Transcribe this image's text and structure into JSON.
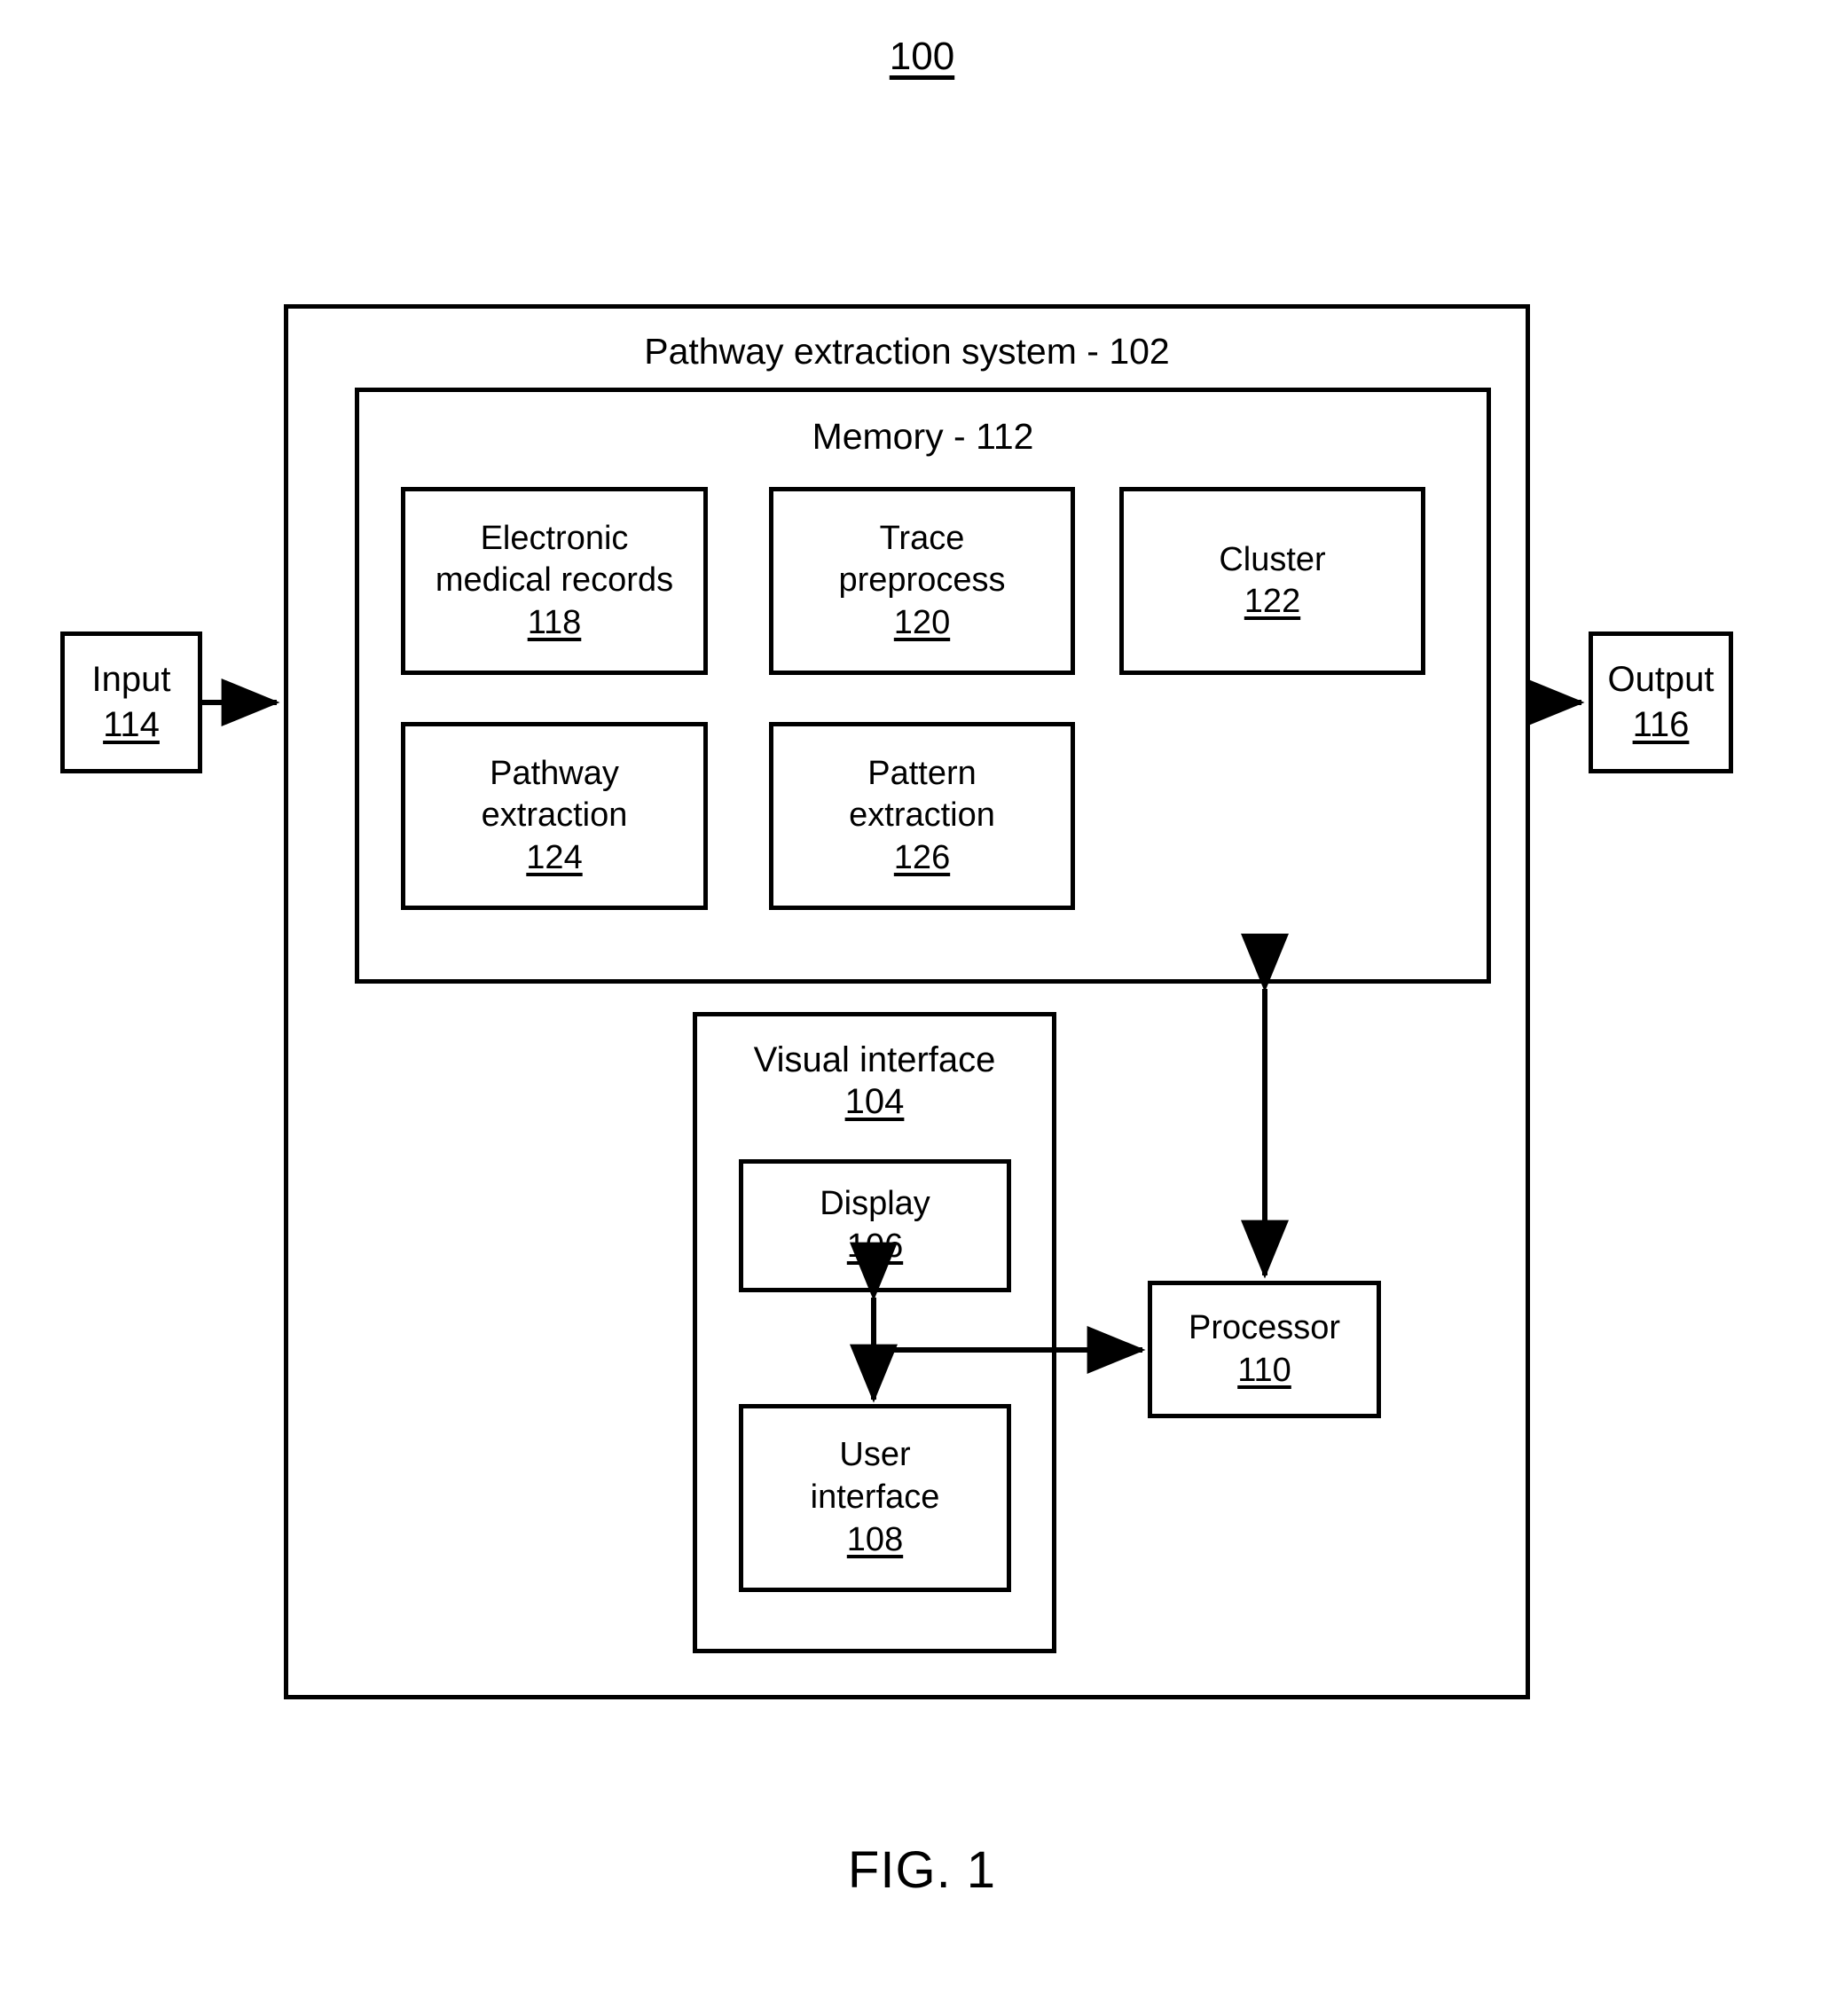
{
  "figure": {
    "number": "100",
    "caption": "FIG. 1"
  },
  "system": {
    "title": "Pathway extraction system - 102",
    "memory": {
      "title": "Memory - 112",
      "modules": [
        {
          "name": "electronic-medical-records",
          "line1": "Electronic",
          "line2": "medical records",
          "ref": "118"
        },
        {
          "name": "trace-preprocess",
          "line1": "Trace",
          "line2": "preprocess",
          "ref": "120"
        },
        {
          "name": "cluster",
          "line1": "Cluster",
          "line2": "",
          "ref": "122"
        },
        {
          "name": "pathway-extraction",
          "line1": "Pathway",
          "line2": "extraction",
          "ref": "124"
        },
        {
          "name": "pattern-extraction",
          "line1": "Pattern",
          "line2": "extraction",
          "ref": "126"
        }
      ]
    },
    "visual_interface": {
      "label": "Visual interface",
      "ref": "104",
      "display": {
        "label": "Display",
        "ref": "106"
      },
      "user_interface": {
        "line1": "User",
        "line2": "interface",
        "ref": "108"
      }
    },
    "processor": {
      "label": "Processor",
      "ref": "110"
    }
  },
  "io": {
    "input": {
      "label": "Input",
      "ref": "114"
    },
    "output": {
      "label": "Output",
      "ref": "116"
    }
  },
  "colors": {
    "stroke": "#000000",
    "background": "#ffffff"
  }
}
